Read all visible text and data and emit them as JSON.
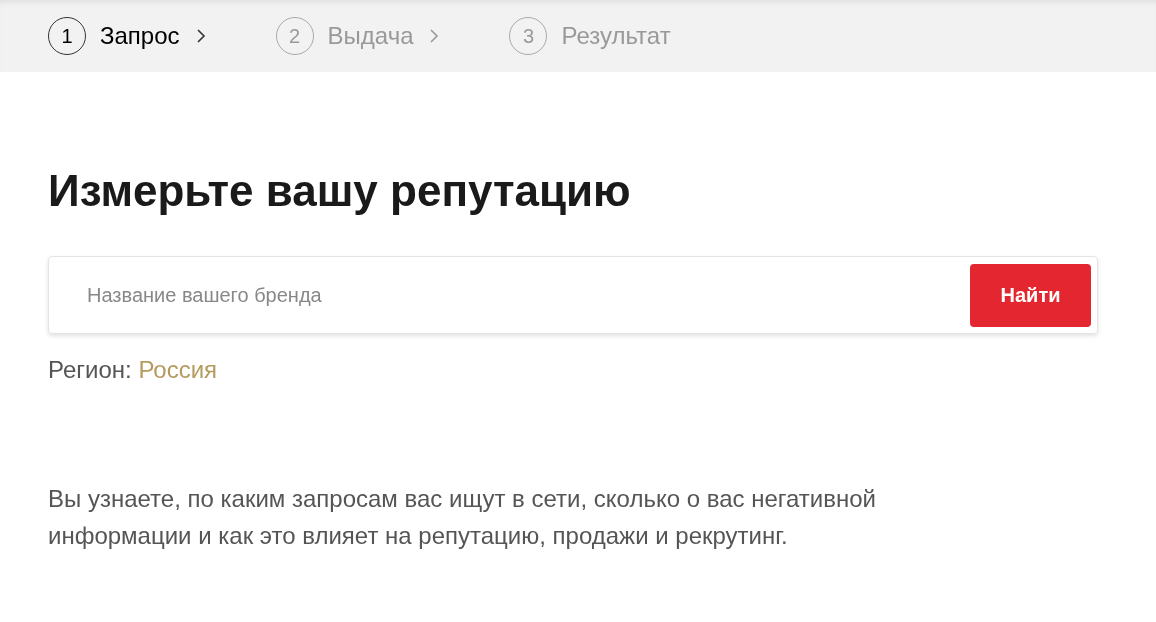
{
  "steps": [
    {
      "number": "1",
      "label": "Запрос",
      "selected": true
    },
    {
      "number": "2",
      "label": "Выдача",
      "selected": false
    },
    {
      "number": "3",
      "label": "Результат",
      "selected": false
    }
  ],
  "heading": "Измерьте вашу репутацию",
  "search": {
    "placeholder": "Название вашего бренда",
    "button": "Найти"
  },
  "region": {
    "label": "Регион:",
    "value": "Россия"
  },
  "description": "Вы узнаете, по каким запросам вас ищут в сети, сколько о вас негативной информации и как это влияет на репутацию, продажи и рекрутинг."
}
